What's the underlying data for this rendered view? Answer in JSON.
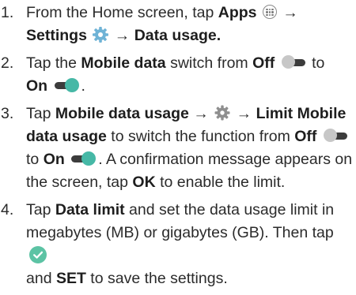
{
  "steps": [
    {
      "number": "1.",
      "parts": {
        "a": "From the Home screen, tap ",
        "b": "Apps",
        "c": " → ",
        "d": "Settings",
        "e": " → ",
        "f": "Data usage."
      }
    },
    {
      "number": "2.",
      "parts": {
        "a": "Tap the ",
        "b": "Mobile data",
        "c": " switch from ",
        "d": "Off",
        "e": " to",
        "f": "On",
        "g": "."
      }
    },
    {
      "number": "3.",
      "parts": {
        "a": "Tap ",
        "b": "Mobile data usage",
        "c": " → ",
        "d": " → ",
        "e": "Limit Mobile data usage",
        "f": " to switch the function from ",
        "g": "Off",
        "h": "to ",
        "i": "On",
        "j": ". A confirmation message appears on the screen, tap ",
        "k": "OK",
        "l": " to enable the limit."
      }
    },
    {
      "number": "4.",
      "parts": {
        "a": "Tap ",
        "b": "Data limit",
        "c": " and set the data usage limit in megabytes (MB) or gigabytes (GB). Then tap ",
        "d": "and ",
        "e": "SET",
        "f": " to save the settings."
      }
    }
  ],
  "icons": {
    "apps": "apps-grid-icon",
    "settings": "gear-icon",
    "switch_off": "toggle-off-icon",
    "switch_on": "toggle-on-icon",
    "confirm": "checkmark-icon"
  },
  "colors": {
    "text": "#2b2b2b",
    "toggle_on": "#46b8a6",
    "toggle_off_knob": "#c7c7c7",
    "toggle_track": "#3c3c3c",
    "check": "#5cc3a4"
  }
}
